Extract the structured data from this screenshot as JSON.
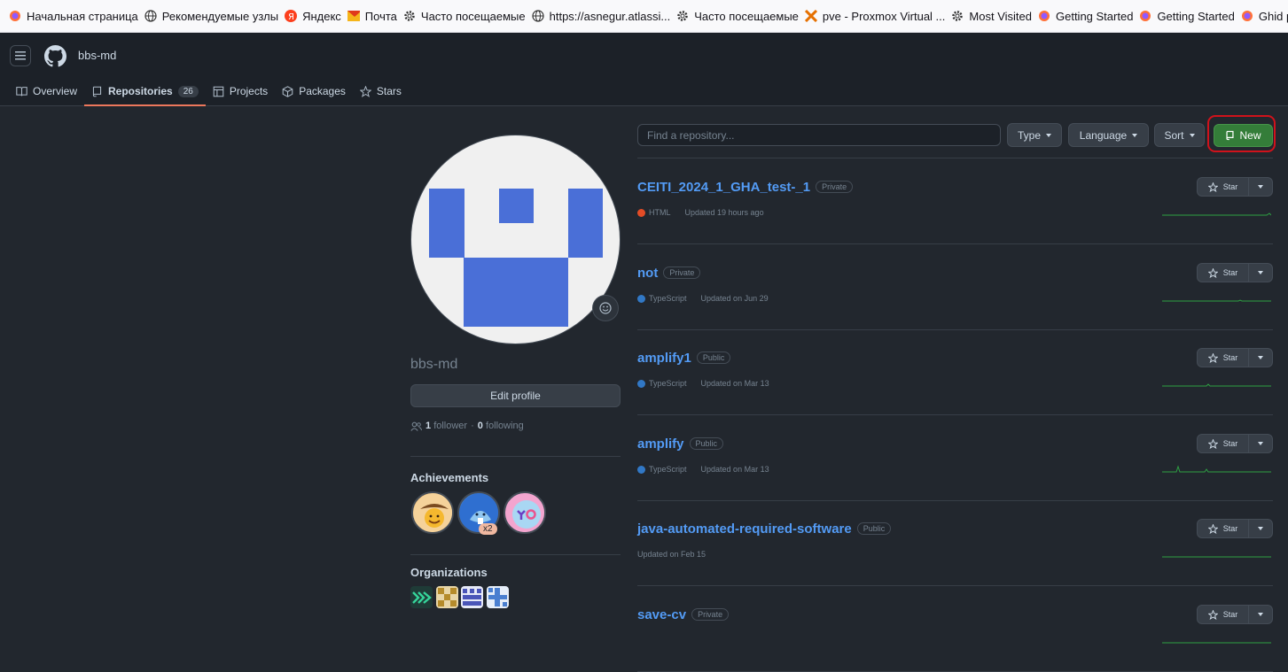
{
  "bookmarks": [
    {
      "label": "Начальная страница",
      "icon": "firefox-icon"
    },
    {
      "label": "Рекомендуемые узлы",
      "icon": "globe-icon"
    },
    {
      "label": "Яндекс",
      "icon": "yandex-icon"
    },
    {
      "label": "Почта",
      "icon": "mail-icon"
    },
    {
      "label": "Часто посещаемые",
      "icon": "gear-icon"
    },
    {
      "label": "https://asnegur.atlassi...",
      "icon": "globe-icon"
    },
    {
      "label": "Часто посещаемые",
      "icon": "gear-icon"
    },
    {
      "label": "pve - Proxmox Virtual ...",
      "icon": "proxmox-icon"
    },
    {
      "label": "Most Visited",
      "icon": "gear-icon"
    },
    {
      "label": "Getting Started",
      "icon": "firefox-icon"
    },
    {
      "label": "Getting Started",
      "icon": "firefox-icon"
    },
    {
      "label": "Ghid pentru î",
      "icon": "firefox-icon"
    }
  ],
  "header": {
    "username": "bbs-md"
  },
  "tabs": [
    {
      "label": "Overview",
      "icon": "book-icon"
    },
    {
      "label": "Repositories",
      "icon": "repo-icon",
      "count": "26"
    },
    {
      "label": "Projects",
      "icon": "table-icon"
    },
    {
      "label": "Packages",
      "icon": "package-icon"
    },
    {
      "label": "Stars",
      "icon": "star-icon"
    }
  ],
  "profile": {
    "username": "bbs-md",
    "edit_label": "Edit profile",
    "followers_count": "1",
    "followers_label": "follower",
    "separator": "·",
    "following_count": "0",
    "following_label": "following",
    "achievements_title": "Achievements",
    "achievement_multiplier": "x2",
    "organizations_title": "Organizations"
  },
  "toolbar": {
    "search_placeholder": "Find a repository...",
    "type_label": "Type",
    "language_label": "Language",
    "sort_label": "Sort",
    "new_label": "New"
  },
  "repos": [
    {
      "name": "CEITI_2024_1_GHA_test-_1",
      "visibility": "Private",
      "language": "HTML",
      "lang_color": "#e34c26",
      "updated": "Updated 19 hours ago",
      "star_label": "Star"
    },
    {
      "name": "not",
      "visibility": "Private",
      "language": "TypeScript",
      "lang_color": "#3178c6",
      "updated": "Updated on Jun 29",
      "star_label": "Star"
    },
    {
      "name": "amplify1",
      "visibility": "Public",
      "language": "TypeScript",
      "lang_color": "#3178c6",
      "updated": "Updated on Mar 13",
      "star_label": "Star"
    },
    {
      "name": "amplify",
      "visibility": "Public",
      "language": "TypeScript",
      "lang_color": "#3178c6",
      "updated": "Updated on Mar 13",
      "star_label": "Star"
    },
    {
      "name": "java-automated-required-software",
      "visibility": "Public",
      "language": "",
      "lang_color": "",
      "updated": "Updated on Feb 15",
      "star_label": "Star"
    },
    {
      "name": "save-cv",
      "visibility": "Private",
      "language": "",
      "lang_color": "",
      "updated": "",
      "star_label": "Star"
    }
  ],
  "colors": {
    "accent_green": "#347d39",
    "highlight_red": "#d0121b",
    "link_blue": "#539bf5",
    "tab_underline": "#ec775c"
  }
}
